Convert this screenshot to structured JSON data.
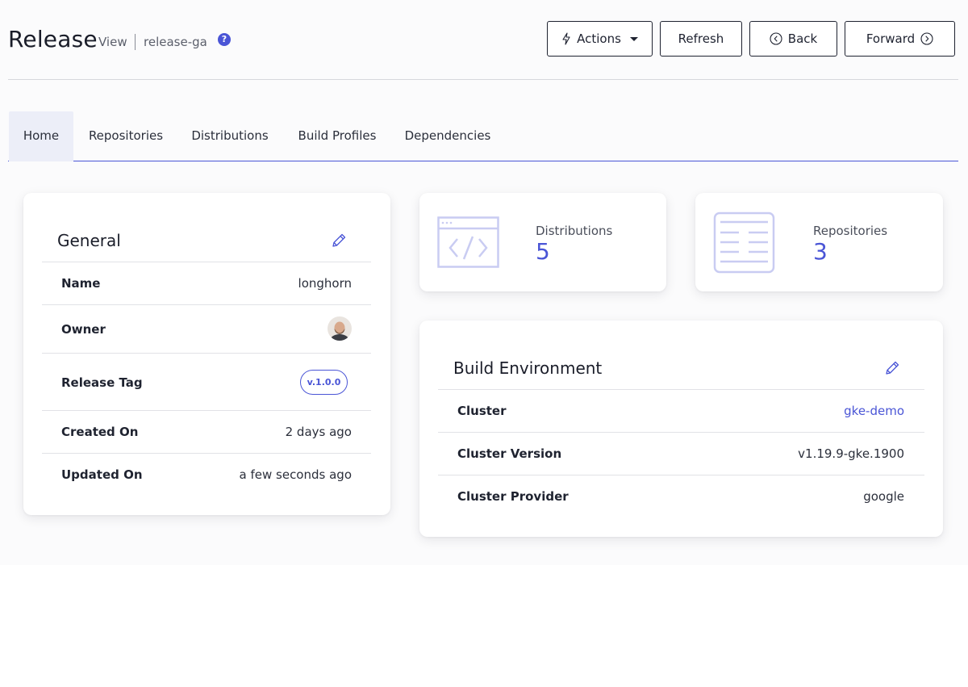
{
  "header": {
    "title": "Release",
    "view_label": "View",
    "breadcrumb": "release-ga",
    "help_glyph": "?",
    "buttons": {
      "actions": "Actions",
      "refresh": "Refresh",
      "back": "Back",
      "forward": "Forward"
    },
    "icons": {
      "actions": "lightning-icon",
      "actions_dropdown": "caret-down-icon",
      "back": "chevron-left-circle-icon",
      "forward": "chevron-right-circle-icon"
    }
  },
  "tabs": [
    {
      "label": "Home",
      "active": true
    },
    {
      "label": "Repositories",
      "active": false
    },
    {
      "label": "Distributions",
      "active": false
    },
    {
      "label": "Build Profiles",
      "active": false
    },
    {
      "label": "Dependencies",
      "active": false
    }
  ],
  "general": {
    "title": "General",
    "rows": {
      "name": {
        "label": "Name",
        "value": "longhorn"
      },
      "owner": {
        "label": "Owner"
      },
      "release_tag": {
        "label": "Release Tag",
        "value": "v.1.0.0"
      },
      "created_on": {
        "label": "Created On",
        "value": "2 days ago"
      },
      "updated_on": {
        "label": "Updated On",
        "value": "a few seconds ago"
      }
    }
  },
  "stats": {
    "distributions": {
      "label": "Distributions",
      "value": "5",
      "icon": "code-window-icon"
    },
    "repositories": {
      "label": "Repositories",
      "value": "3",
      "icon": "list-document-icon"
    }
  },
  "build_environment": {
    "title": "Build Environment",
    "rows": {
      "cluster": {
        "label": "Cluster",
        "value": "gke-demo"
      },
      "cluster_version": {
        "label": "Cluster Version",
        "value": "v1.19.9-gke.1900"
      },
      "cluster_provider": {
        "label": "Cluster Provider",
        "value": "google"
      }
    }
  },
  "colors": {
    "accent": "#4a55d6",
    "icon_light": "#c9ccf2",
    "text": "#1f2330"
  }
}
